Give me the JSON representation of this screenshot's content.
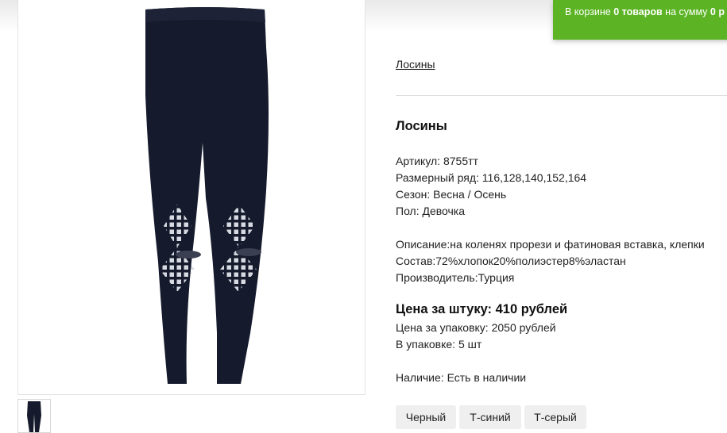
{
  "cart": {
    "prefix": "В корзине ",
    "count": "0 товаров",
    "middle": " на сумму ",
    "sum": "0 р"
  },
  "breadcrumb": "Лосины",
  "product": {
    "title": "Лосины",
    "article": "Артикул: 8755тт",
    "sizes": "Размерный ряд: 116,128,140,152,164",
    "season": "Сезон: Весна / Осень",
    "gender": "Пол: Девочка",
    "description": "Описание:на коленях прорези и фатиновая вставка, клепки",
    "composition": "Состав:72%хлопок20%полиэстер8%эластан",
    "manufacturer": "Производитель:Турция",
    "price_unit": "Цена за штуку: 410 рублей",
    "price_pack": "Цена за упаковку: 2050 рублей",
    "pack_qty": "В упаковке: 5 шт",
    "availability": "Наличие: Есть в наличии"
  },
  "colors": [
    "Черный",
    "Т-синий",
    "Т-серый"
  ],
  "accent": {
    "cart_green": "#5cb424",
    "legging_navy": "#151a2c"
  }
}
